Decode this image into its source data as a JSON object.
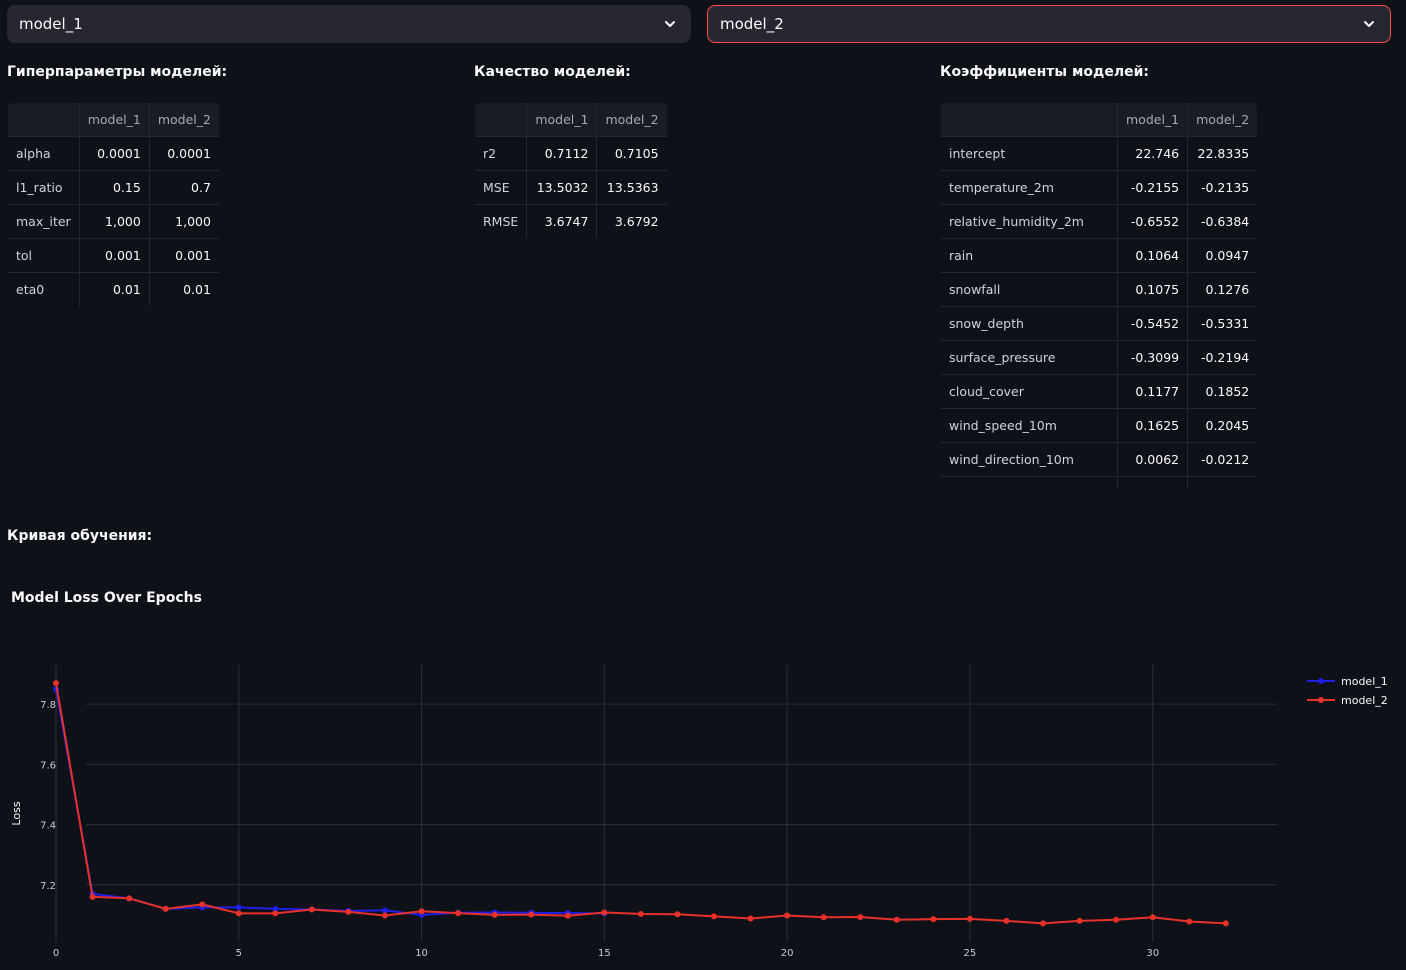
{
  "selects": {
    "left": {
      "value": "model_1"
    },
    "right": {
      "value": "model_2"
    }
  },
  "sections": {
    "hyperparams": "Гиперпараметры моделей:",
    "quality": "Качество моделей:",
    "coefficients": "Коэффициенты моделей:",
    "learning_curve": "Кривая обучения:"
  },
  "hyperparams_table": {
    "columns": [
      "model_1",
      "model_2"
    ],
    "rows": [
      {
        "label": "alpha",
        "values": [
          "0.0001",
          "0.0001"
        ]
      },
      {
        "label": "l1_ratio",
        "values": [
          "0.15",
          "0.7"
        ]
      },
      {
        "label": "max_iter",
        "values": [
          "1,000",
          "1,000"
        ]
      },
      {
        "label": "tol",
        "values": [
          "0.001",
          "0.001"
        ]
      },
      {
        "label": "eta0",
        "values": [
          "0.01",
          "0.01"
        ]
      }
    ]
  },
  "quality_table": {
    "columns": [
      "model_1",
      "model_2"
    ],
    "rows": [
      {
        "label": "r2",
        "values": [
          "0.7112",
          "0.7105"
        ]
      },
      {
        "label": "MSE",
        "values": [
          "13.5032",
          "13.5363"
        ]
      },
      {
        "label": "RMSE",
        "values": [
          "3.6747",
          "3.6792"
        ]
      }
    ]
  },
  "coef_table": {
    "columns": [
      "model_1",
      "model_2"
    ],
    "rows": [
      {
        "label": "intercept",
        "values": [
          "22.746",
          "22.8335"
        ]
      },
      {
        "label": "temperature_2m",
        "values": [
          "-0.2155",
          "-0.2135"
        ]
      },
      {
        "label": "relative_humidity_2m",
        "values": [
          "-0.6552",
          "-0.6384"
        ]
      },
      {
        "label": "rain",
        "values": [
          "0.1064",
          "0.0947"
        ]
      },
      {
        "label": "snowfall",
        "values": [
          "0.1075",
          "0.1276"
        ]
      },
      {
        "label": "snow_depth",
        "values": [
          "-0.5452",
          "-0.5331"
        ]
      },
      {
        "label": "surface_pressure",
        "values": [
          "-0.3099",
          "-0.2194"
        ]
      },
      {
        "label": "cloud_cover",
        "values": [
          "0.1177",
          "0.1852"
        ]
      },
      {
        "label": "wind_speed_10m",
        "values": [
          "0.1625",
          "0.2045"
        ]
      },
      {
        "label": "wind_direction_10m",
        "values": [
          "0.0062",
          "-0.0212"
        ]
      }
    ]
  },
  "chart_data": {
    "type": "line",
    "title": "Model Loss Over Epochs",
    "xlabel": "",
    "ylabel": "Loss",
    "xlim": [
      0,
      33.4
    ],
    "ylim": [
      7.01,
      7.93
    ],
    "xticks": [
      0,
      5,
      10,
      15,
      20,
      25,
      30
    ],
    "yticks": [
      7.2,
      7.4,
      7.6,
      7.8
    ],
    "grid": true,
    "legend_position": "top-right",
    "series": [
      {
        "name": "model_1",
        "color": "#1f1fe6",
        "x": [
          0,
          1,
          2,
          3,
          4,
          5,
          6,
          7,
          8,
          9,
          10,
          11,
          12,
          13,
          14,
          15
        ],
        "y": [
          7.85,
          7.17,
          7.155,
          7.12,
          7.125,
          7.125,
          7.12,
          7.118,
          7.113,
          7.115,
          7.1,
          7.107,
          7.108,
          7.107,
          7.106,
          7.105
        ]
      },
      {
        "name": "model_2",
        "color": "#e8312a",
        "x": [
          0,
          1,
          2,
          3,
          4,
          5,
          6,
          7,
          8,
          9,
          10,
          11,
          12,
          13,
          14,
          15,
          16,
          17,
          18,
          19,
          20,
          21,
          22,
          23,
          24,
          25,
          26,
          27,
          28,
          29,
          30,
          31,
          32
        ],
        "y": [
          7.87,
          7.16,
          7.155,
          7.12,
          7.135,
          7.105,
          7.105,
          7.118,
          7.11,
          7.098,
          7.112,
          7.106,
          7.1,
          7.101,
          7.097,
          7.108,
          7.103,
          7.102,
          7.095,
          7.088,
          7.098,
          7.092,
          7.093,
          7.084,
          7.086,
          7.087,
          7.08,
          7.072,
          7.08,
          7.084,
          7.092,
          7.078,
          7.072
        ]
      }
    ]
  }
}
